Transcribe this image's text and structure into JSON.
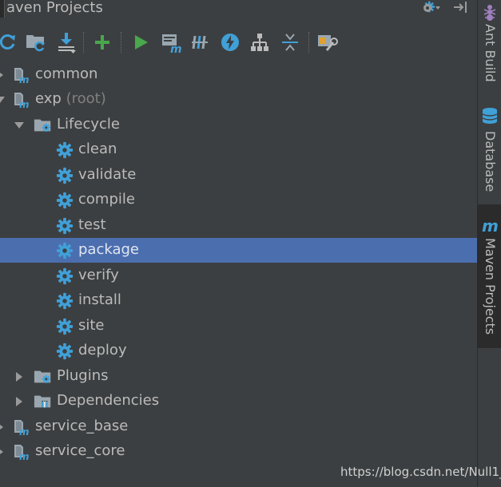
{
  "window": {
    "title": "aven Projects"
  },
  "toolbar": {
    "buttons": [
      {
        "name": "reimport-all",
        "icon": "refresh-icon"
      },
      {
        "name": "generate-sources",
        "icon": "folder-refresh-icon"
      },
      {
        "name": "download-sources",
        "icon": "download-icon"
      },
      {
        "name": "add-project",
        "icon": "plus-icon"
      },
      {
        "name": "run-goal",
        "icon": "run-icon"
      },
      {
        "name": "execute-goal",
        "icon": "maven-goal-icon"
      },
      {
        "name": "toggle-offline",
        "icon": "offline-icon"
      },
      {
        "name": "skip-tests",
        "icon": "lightning-icon"
      },
      {
        "name": "show-dependencies",
        "icon": "diagram-icon"
      },
      {
        "name": "collapse-all",
        "icon": "collapse-icon"
      },
      {
        "name": "settings",
        "icon": "wrench-icon"
      }
    ]
  },
  "tree": {
    "common": "common",
    "exp": "exp",
    "exp_suffix": "(root)",
    "lifecycle": "Lifecycle",
    "phases": [
      "clean",
      "validate",
      "compile",
      "test",
      "package",
      "verify",
      "install",
      "site",
      "deploy"
    ],
    "selected_phase": "package",
    "plugins": "Plugins",
    "dependencies": "Dependencies",
    "service_base": "service_base",
    "service_core": "service_core"
  },
  "sidebar": {
    "tabs": [
      {
        "label": "Ant Build",
        "icon": "ant-icon"
      },
      {
        "label": "Database",
        "icon": "database-icon"
      },
      {
        "label": "Maven Projects",
        "icon": "maven-icon"
      }
    ]
  },
  "watermark": "https://blog.csdn.net/Null1_",
  "colors": {
    "panel_bg": "#3c3f41",
    "selection": "#4b6eaf",
    "gear_blue": "#40a0d8",
    "green": "#49a74c",
    "text": "#bbbbbb",
    "muted": "#808080"
  }
}
